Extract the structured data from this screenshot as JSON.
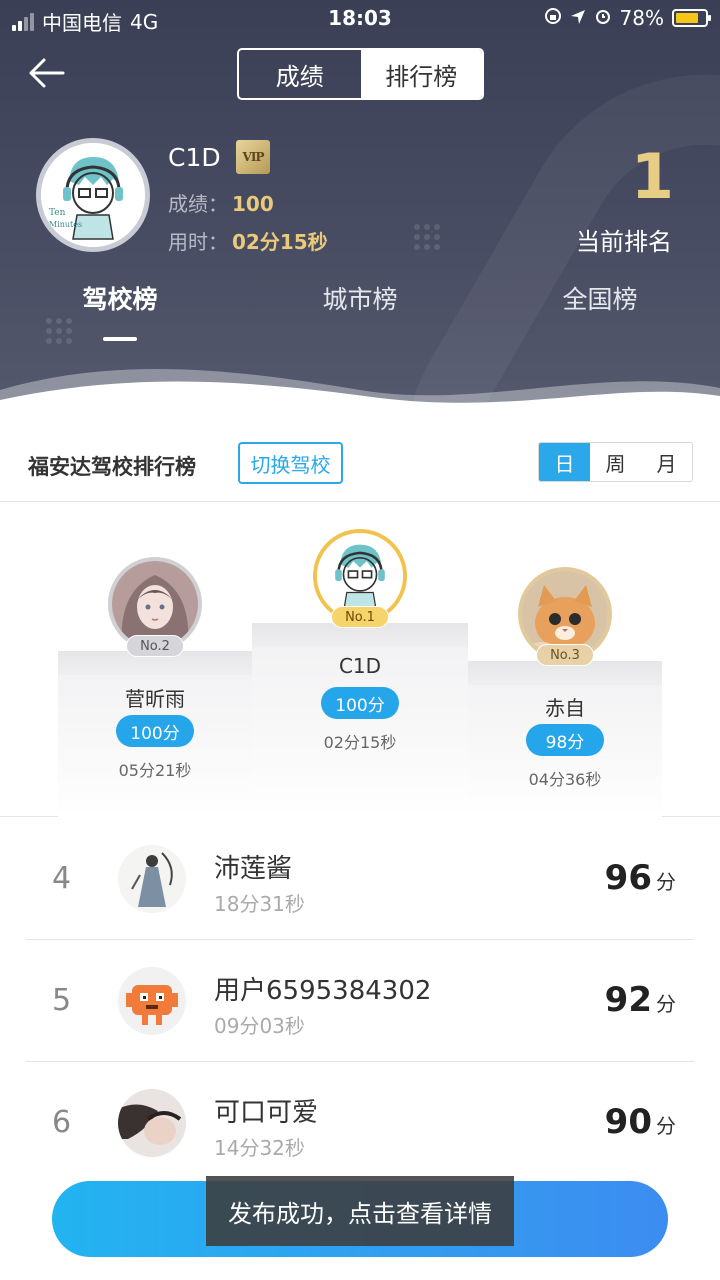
{
  "status_bar": {
    "carrier": "中国电信",
    "network": "4G",
    "time": "18:03",
    "battery": "78%",
    "battery_level": 0.78
  },
  "header": {
    "tabs": [
      "成绩",
      "排行榜"
    ],
    "active_tab": "排行榜",
    "user": {
      "name": "C1D",
      "vip": "VIP",
      "score_label": "成绩：",
      "score": "100",
      "time_label": "用时：",
      "time": "02分15秒"
    },
    "rank": {
      "value": "1",
      "label": "当前排名"
    },
    "board_tabs": [
      "驾校榜",
      "城市榜",
      "全国榜"
    ],
    "active_board_tab": "驾校榜"
  },
  "board": {
    "title": "福安达驾校排行榜",
    "switch_label": "切换驾校",
    "periods": [
      "日",
      "周",
      "月"
    ],
    "active_period": "日"
  },
  "podium": [
    {
      "place": "No.1",
      "name": "C1D",
      "score": "100分",
      "time": "02分15秒"
    },
    {
      "place": "No.2",
      "name": "菅昕雨",
      "score": "100分",
      "time": "05分21秒"
    },
    {
      "place": "No.3",
      "name": "赤自",
      "score": "98分",
      "time": "04分36秒"
    }
  ],
  "list": [
    {
      "rank": "4",
      "name": "沛莲酱",
      "time": "18分31秒",
      "score": "96",
      "unit": "分"
    },
    {
      "rank": "5",
      "name": "用户6595384302",
      "time": "09分03秒",
      "score": "92",
      "unit": "分"
    },
    {
      "rank": "6",
      "name": "可口可爱",
      "time": "14分32秒",
      "score": "90",
      "unit": "分"
    }
  ],
  "toast": "发布成功，点击查看详情",
  "colors": {
    "accent": "#2aa8ea",
    "gold": "#e8cd84",
    "header_bg": "#3a3f55"
  }
}
